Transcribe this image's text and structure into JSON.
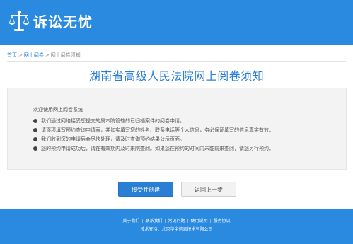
{
  "header": {
    "brand": "诉讼无忧",
    "logo_icon": "scales-of-justice-icon",
    "background_color": "#2a8ae0"
  },
  "breadcrumb": {
    "items": [
      "首页",
      "网上阅卷",
      "网上阅卷须知"
    ],
    "separator": ">"
  },
  "page_title": "湖南省高级人民法院网上阅卷须知",
  "notice": {
    "intro": "欢迎使用网上阅卷系统",
    "items": [
      "我们通过网络接受您提交的属本院管辖的已归档案件的阅卷申请。",
      "请逐项填写预约查询申请表，并如实填写您的姓名、联系电话等个人信息，务必保证填写的信息真实有效。",
      "我们收到您的申请后会尽快处理，请及时查询预约结果公示页面。",
      "您的预约申请成功后，请在有效期内及时来院查阅。如果您在预约的时间内未能前来查阅，请您另行预约。"
    ],
    "bullet_icon": "bullet-dot-icon"
  },
  "buttons": {
    "accept": "接受并创建",
    "back": "返回上一步"
  },
  "footer": {
    "links": [
      "关于我们",
      "联系我们",
      "常见问题",
      "使用说明",
      "服务协议"
    ],
    "link_separator": "|",
    "support": "技术支持：北京华宇信息技术有限公司"
  },
  "colors": {
    "brand_blue": "#2a8ae0",
    "title_blue": "#2a7fd4"
  }
}
